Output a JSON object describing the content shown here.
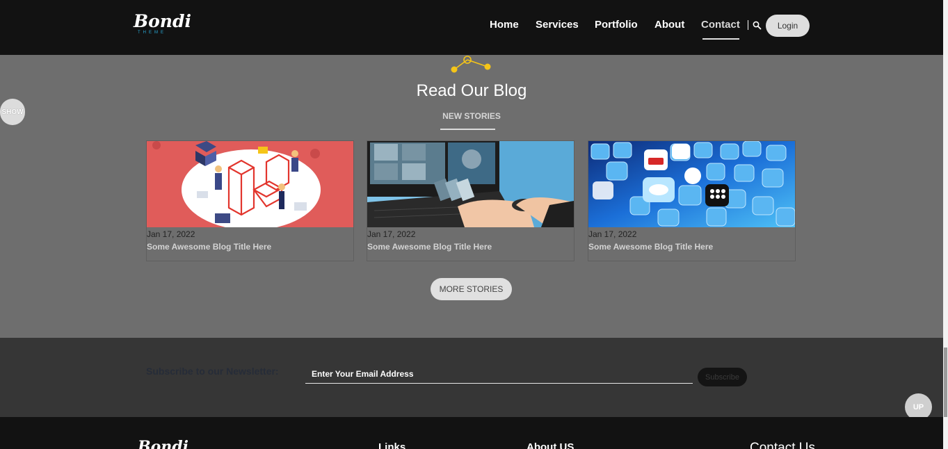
{
  "header": {
    "logo": {
      "script": "Bondi",
      "sub": "THEME"
    },
    "nav": [
      {
        "label": "Home",
        "active": false
      },
      {
        "label": "Services",
        "active": false
      },
      {
        "label": "Portfolio",
        "active": false
      },
      {
        "label": "About",
        "active": false
      },
      {
        "label": "Contact",
        "active": true
      }
    ],
    "login_label": "Login"
  },
  "blog": {
    "title": "Read Our Blog",
    "subtitle": "NEW STORIES",
    "show_label": "SHOW",
    "posts": [
      {
        "date": "Jan 17, 2022",
        "title": "Some Awesome Blog Title Here",
        "image": "laravel-illustration"
      },
      {
        "date": "Jan 17, 2022",
        "title": "Some Awesome Blog Title Here",
        "image": "designer-desk-photo"
      },
      {
        "date": "Jan 17, 2022",
        "title": "Some Awesome Blog Title Here",
        "image": "social-media-icons-photo"
      }
    ],
    "more_label": "MORE STORIES"
  },
  "newsletter": {
    "label": "Subscribe to our Newsletter:",
    "placeholder": "Enter Your Email Address",
    "button_label": "Subscribe"
  },
  "up_label": "UP",
  "footer": {
    "logo": "Bondi",
    "links_heading": "Links",
    "about_heading": "About US",
    "contact_heading": "Contact Us"
  },
  "colors": {
    "header_bg": "#121212",
    "section_bg": "#6e6e6e",
    "newsletter_bg": "#363636",
    "accent_yellow": "#f5c518",
    "logo_blue": "#2aa9d6"
  }
}
